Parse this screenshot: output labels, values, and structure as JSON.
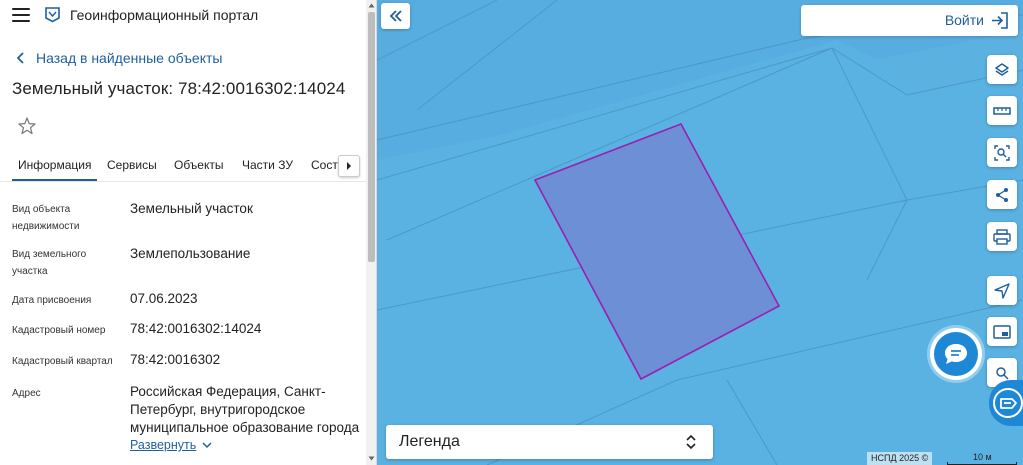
{
  "header": {
    "portal_title": "Геоинформационный портал",
    "back_label": "Назад в найденные объекты"
  },
  "object": {
    "title": "Земельный участок: 78:42:0016302:14024"
  },
  "tabs": [
    {
      "label": "Информация",
      "active": true
    },
    {
      "label": "Сервисы",
      "active": false
    },
    {
      "label": "Объекты",
      "active": false
    },
    {
      "label": "Части ЗУ",
      "active": false
    },
    {
      "label": "Соста",
      "active": false
    }
  ],
  "properties": [
    {
      "label": "Вид объекта недвижимости",
      "value": "Земельный участок"
    },
    {
      "label": "Вид земельного участка",
      "value": "Землепользование"
    },
    {
      "label": "Дата присвоения",
      "value": "07.06.2023"
    },
    {
      "label": "Кадастровый номер",
      "value": "78:42:0016302:14024"
    },
    {
      "label": "Кадастровый квартал",
      "value": "78:42:0016302"
    },
    {
      "label": "Адрес",
      "value": "Российская Федерация, Санкт-Петербург, внутригородское муниципальное образование города"
    }
  ],
  "expand_label": "Развернуть",
  "map": {
    "login_label": "Войти",
    "legend_title": "Легенда",
    "attribution": "НСПД 2025 ©",
    "scale_label": "10 м",
    "colors": {
      "map_background": "#5bb1df",
      "parcel_fill": "#6c8fd6",
      "parcel_stroke": "#9b1fb0",
      "accent": "#1e88d6",
      "link": "#1f5f9e"
    },
    "tools": [
      "layers-icon",
      "ruler-icon",
      "select-area-icon",
      "share-icon",
      "print-icon",
      "navigate-icon",
      "picture-in-picture-icon",
      "location-search-icon"
    ]
  }
}
